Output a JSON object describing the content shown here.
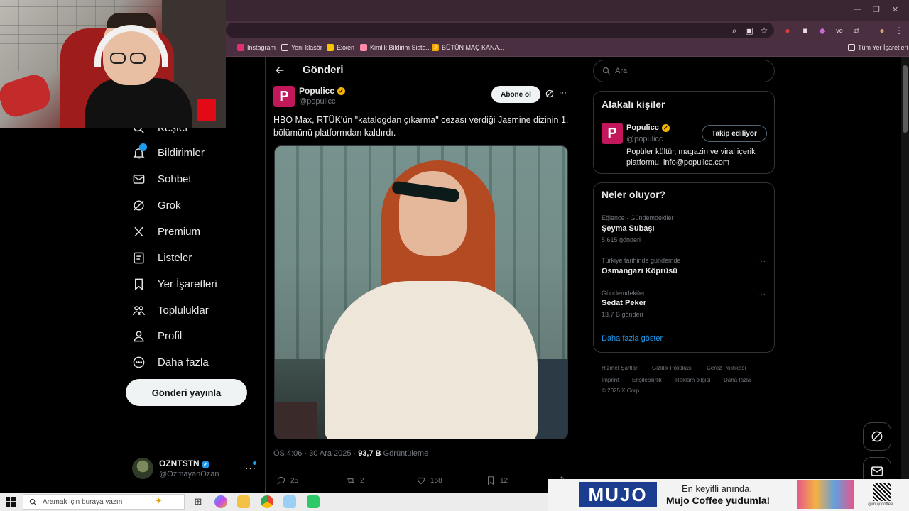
{
  "browser": {
    "bookmarks": [
      {
        "label": "Instagram",
        "icon": "instagram-icon",
        "color": "#e1306c"
      },
      {
        "label": "Yeni klasör",
        "icon": "folder-icon",
        "color": "#eadde4"
      },
      {
        "label": "Exxen",
        "icon": "exxen-icon",
        "color": "#f6c500"
      },
      {
        "label": "Kimlik Bildirim Siste...",
        "icon": "link-icon",
        "color": "#ff8aa8"
      },
      {
        "label": "BÜTÜN MAÇ KANA...",
        "icon": "jp-icon",
        "color": "#f6a800"
      }
    ],
    "all_bookmarks": "Tüm Yer İşaretleri"
  },
  "nav": {
    "explore": "Keşfet",
    "items": [
      {
        "label": "Bildirimler",
        "icon": "bell-icon"
      },
      {
        "label": "Sohbet",
        "icon": "mail-icon"
      },
      {
        "label": "Grok",
        "icon": "grok-icon"
      },
      {
        "label": "Premium",
        "icon": "x-logo-icon"
      },
      {
        "label": "Listeler",
        "icon": "list-icon"
      },
      {
        "label": "Yer İşaretleri",
        "icon": "bookmark-icon"
      },
      {
        "label": "Topluluklar",
        "icon": "communities-icon"
      },
      {
        "label": "Profil",
        "icon": "person-icon"
      },
      {
        "label": "Daha fazla",
        "icon": "more-circle-icon"
      }
    ],
    "notif_count": "1",
    "post_button": "Gönderi yayınla"
  },
  "account": {
    "name": "OZNTSTN",
    "handle": "@OzmayanOzan"
  },
  "post": {
    "header": "Gönderi",
    "author_name": "Populicc",
    "author_handle": "@populicc",
    "avatar_letter": "P",
    "subscribe": "Abone ol",
    "text": "HBO Max, RTÜK'ün \"katalogdan çıkarma\" cezası verdiği Jasmine dizinin 1. bölümünü platformdan kaldırdı.",
    "time": "ÖS 4:06 · 30 Ara 2025 ·",
    "views": "93,7 B",
    "views_label": "Görüntüleme",
    "replies": "25",
    "reposts": "2",
    "likes": "168",
    "bookmarks": "12"
  },
  "right": {
    "search_placeholder": "Ara",
    "related_title": "Alakalı kişiler",
    "related": {
      "name": "Populicc",
      "handle": "@populicc",
      "follow": "Takip ediliyor",
      "bio": "Popüler kültür, magazin ve viral içerik platformu. info@populicc.com"
    },
    "trends_title": "Neler oluyor?",
    "trends": [
      {
        "category": "Eğlence · Gündemdekiler",
        "name": "Şeyma Subaşı",
        "count": "5.615 gönderi"
      },
      {
        "category": "Türkiye tarihinde gündemde",
        "name": "Osmangazi Köprüsü",
        "count": ""
      },
      {
        "category": "Gündemdekiler",
        "name": "Sedat Peker",
        "count": "13,7 B gönderi"
      }
    ],
    "show_more": "Daha fazla göster",
    "footer": {
      "terms": "Hizmet Şartları",
      "privacy": "Gizlilik Politikası",
      "cookies": "Çerez Politikası",
      "imprint": "Imprint",
      "accessibility": "Erişilebilirlik",
      "ads": "Reklam bilgisi",
      "more": "Daha fazla ···",
      "copyright": "© 2025 X Corp."
    }
  },
  "taskbar": {
    "search_placeholder": "Aramak için buraya yazın"
  },
  "ad": {
    "brand": "MUJO",
    "line1": "En keyifli anında,",
    "line2": "Mujo Coffee yudumla!",
    "social": "@mujocoffee"
  },
  "colors": {
    "accent": "#1d9bf0",
    "brand_pink": "#c2185b",
    "verified": "#f4b400"
  }
}
